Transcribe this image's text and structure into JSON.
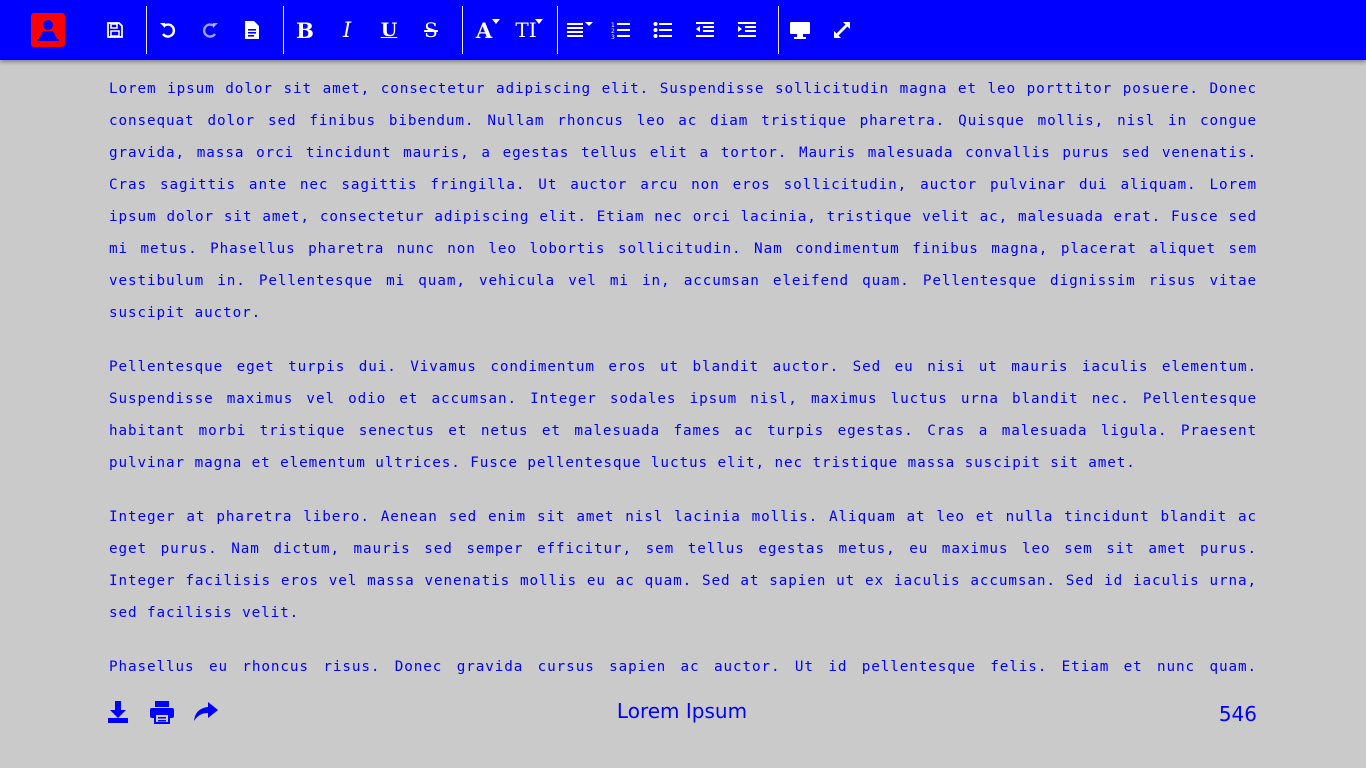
{
  "colors": {
    "toolbar_bg": "#0000ff",
    "page_bg": "#cacaca",
    "text": "#0000ff",
    "logo_bg": "#ff0000"
  },
  "toolbar": {
    "icons": [
      "logo-icon",
      "save-icon",
      "undo-icon",
      "redo-icon",
      "new-document-icon",
      "bold-icon",
      "italic-icon",
      "underline-icon",
      "strikethrough-icon",
      "font-size-icon",
      "text-size-icon",
      "align-icon",
      "ordered-list-icon",
      "unordered-list-icon",
      "outdent-icon",
      "indent-icon",
      "desktop-icon",
      "fullscreen-icon"
    ],
    "bold_label": "B",
    "italic_label": "I",
    "underline_label": "U",
    "strike_label": "S",
    "font_label": "A",
    "textsize_label": "TI"
  },
  "document": {
    "paragraphs": [
      "Lorem ipsum dolor sit amet, consectetur adipiscing elit. Suspendisse sollicitudin magna et leo porttitor posuere. Donec consequat dolor sed finibus bibendum. Nullam rhoncus leo ac diam tristique pharetra. Quisque mollis, nisl in congue gravida, massa orci tincidunt mauris, a egestas tellus elit a tortor. Mauris malesuada convallis purus sed venenatis. Cras sagittis ante nec sagittis fringilla. Ut auctor arcu non eros sollicitudin, auctor pulvinar dui aliquam. Lorem ipsum dolor sit amet, consectetur adipiscing elit. Etiam nec orci lacinia, tristique velit ac, malesuada erat. Fusce sed mi metus. Phasellus pharetra nunc non leo lobortis sollicitudin. Nam condimentum finibus magna, placerat aliquet sem vestibulum in. Pellentesque mi quam, vehicula vel mi in, accumsan eleifend quam. Pellentesque dignissim risus vitae suscipit auctor.",
      "Pellentesque eget turpis dui. Vivamus condimentum eros ut blandit auctor. Sed eu nisi ut mauris iaculis elementum. Suspendisse maximus vel odio et accumsan. Integer sodales ipsum nisl, maximus luctus urna blandit nec. Pellentesque habitant morbi tristique senectus et netus et malesuada fames ac turpis egestas. Cras a malesuada ligula. Praesent pulvinar magna et elementum ultrices. Fusce pellentesque luctus elit, nec tristique massa suscipit sit amet.",
      "Integer at pharetra libero. Aenean sed enim sit amet nisl lacinia mollis. Aliquam at leo et nulla tincidunt blandit ac eget purus. Nam dictum, mauris sed semper efficitur, sem tellus egestas metus, eu maximus leo sem sit amet purus. Integer facilisis eros vel massa venenatis mollis eu ac quam. Sed at sapien ut ex iaculis accumsan. Sed id iaculis urna, sed facilisis velit.",
      "Phasellus eu rhoncus risus. Donec gravida cursus sapien ac auctor. Ut id pellentesque felis. Etiam et nunc quam. Vestibulum ante ipsum primis in faucibus orci luctus et ultrices posuere cubilia curae."
    ]
  },
  "footer": {
    "icons": [
      "download-icon",
      "print-icon",
      "share-icon"
    ],
    "title": "Lorem Ipsum",
    "page_count": "546"
  }
}
